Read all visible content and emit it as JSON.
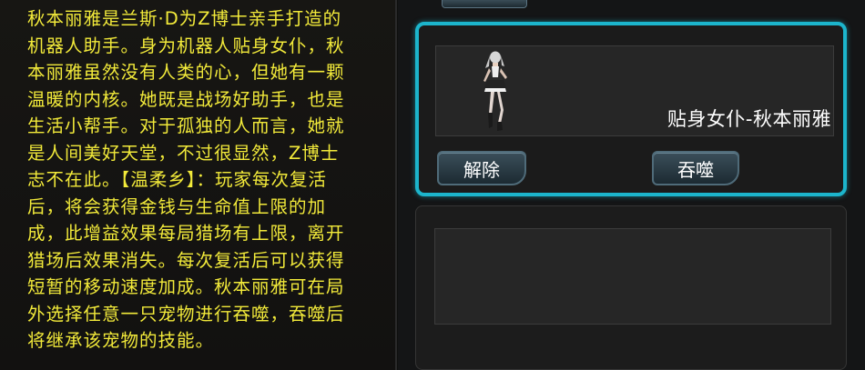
{
  "description": {
    "text": "秋本丽雅是兰斯·D为Z博士亲手打造的\n机器人助手。身为机器人贴身女仆，秋\n本丽雅虽然没有人类的心，但她有一颗\n温暖的内核。她既是战场好助手，也是\n生活小帮手。对于孤独的人而言，她就\n是人间美好天堂，不过很显然，Z博士\n志不在此。【温柔乡】：玩家每次复活\n后，将会获得金钱与生命值上限的加\n成，此增益效果每局猎场有上限，离开\n猎场后效果消失。每次复活后可以获得\n短暂的移动速度加成。秋本丽雅可在局\n外选择任意一只宠物进行吞噬，吞噬后\n将继承该宠物的技能。"
  },
  "pet_slot": {
    "name": "贴身女仆-秋本丽雅",
    "release_label": "解除",
    "devour_label": "吞噬"
  },
  "colors": {
    "text_yellow": "#f2ea3a",
    "highlight_cyan": "#1cb5cc"
  }
}
